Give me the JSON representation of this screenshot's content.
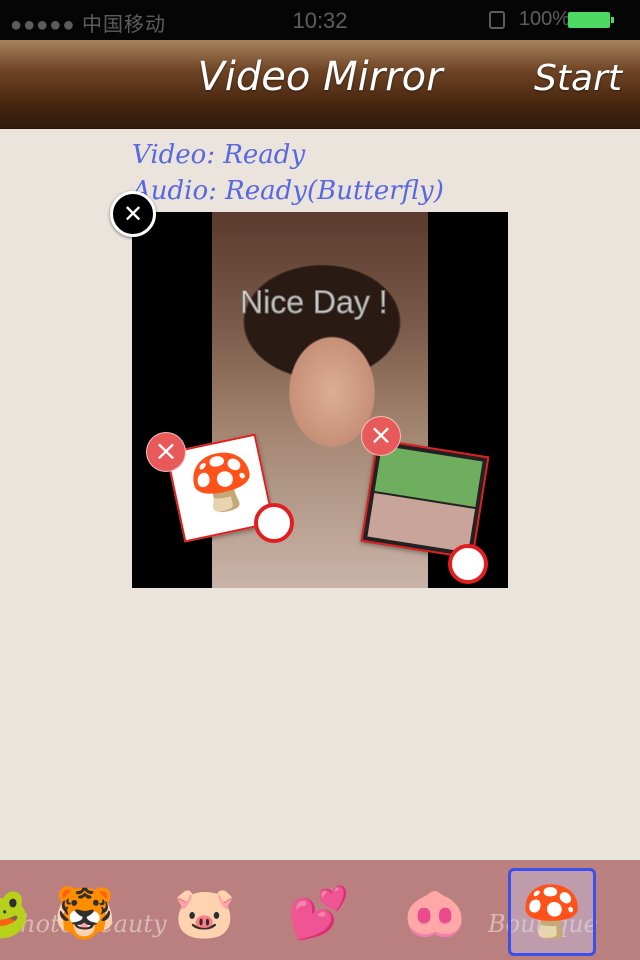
{
  "status_bar": {
    "carrier": "●●●●● 中国移动",
    "time": "10:32",
    "battery_pct": "100%",
    "battery_level": 1.0
  },
  "nav": {
    "title": "Video Mirror",
    "start_label": "Start"
  },
  "status": {
    "video": "Video: Ready",
    "audio": "Audio: Ready(Butterfly)"
  },
  "video": {
    "overlay_text": "Nice Day !"
  },
  "sticker_bar": {
    "left_label": "Photo Beauty",
    "right_label": "Boutique",
    "selected_index": 5
  }
}
